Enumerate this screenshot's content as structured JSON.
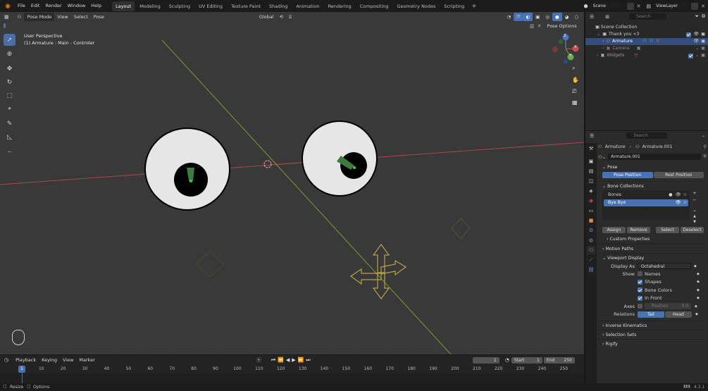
{
  "menu": [
    "File",
    "Edit",
    "Render",
    "Window",
    "Help"
  ],
  "workspaces": [
    "Layout",
    "Modeling",
    "Sculpting",
    "UV Editing",
    "Texture Paint",
    "Shading",
    "Animation",
    "Rendering",
    "Compositing",
    "Geometry Nodes",
    "Scripting"
  ],
  "active_workspace": "Layout",
  "scene": "Scene",
  "view_layer": "ViewLayer",
  "viewport": {
    "mode": "Pose Mode",
    "menus": [
      "View",
      "Select",
      "Pose"
    ],
    "transform_orientation": "Global",
    "pose_options": "Pose Options",
    "overlay_line1": "User Perspective",
    "overlay_line2": "(1) Armature : Main - Controler",
    "gizmo_axes": [
      "Z",
      "X",
      "Y"
    ]
  },
  "outliner": {
    "search_placeholder": "Search",
    "items": [
      {
        "label": "Scene Collection",
        "indent": 0
      },
      {
        "label": "Thank you <3",
        "indent": 1
      },
      {
        "label": "Armature",
        "indent": 2,
        "selected": true
      },
      {
        "label": "Camera",
        "indent": 2,
        "dim": true
      },
      {
        "label": "Widgets",
        "indent": 1,
        "dim": true
      }
    ]
  },
  "properties": {
    "search_placeholder": "Search",
    "breadcrumb_object": "Armature",
    "breadcrumb_data": "Armature.001",
    "data_name": "Armature.001",
    "pose_section": "Pose",
    "pose_position": "Pose Position",
    "rest_position": "Rest Position",
    "bone_collections_section": "Bone Collections",
    "bone_collections": [
      {
        "name": "Bones",
        "selected": false
      },
      {
        "name": "Bye Bye",
        "selected": true
      }
    ],
    "assign": "Assign",
    "remove": "Remove",
    "select": "Select",
    "deselect": "Deselect",
    "custom_properties": "Custom Properties",
    "motion_paths": "Motion Paths",
    "viewport_display": "Viewport Display",
    "display_as_label": "Display As",
    "display_as_value": "Octahedral",
    "show_label": "Show",
    "names": "Names",
    "shapes": "Shapes",
    "bone_colors": "Bone Colors",
    "in_front": "In Front",
    "axes_label": "Axes",
    "position_label": "Position",
    "position_value": "0.0",
    "relations_label": "Relations",
    "tail": "Tail",
    "head": "Head",
    "inverse_kinematics": "Inverse Kinematics",
    "selection_sets": "Selection Sets",
    "rigify": "Rigify"
  },
  "timeline": {
    "menus": [
      "Playback",
      "Keying",
      "View",
      "Marker"
    ],
    "current_frame": "1",
    "start_label": "Start",
    "start": "1",
    "end_label": "End",
    "end": "250",
    "ticks": [
      "1",
      "10",
      "20",
      "30",
      "40",
      "50",
      "60",
      "70",
      "80",
      "90",
      "100",
      "110",
      "120",
      "130",
      "140",
      "150",
      "160",
      "170",
      "180",
      "190",
      "200",
      "210",
      "220",
      "230",
      "240",
      "250"
    ]
  },
  "status": {
    "left1": "Resize",
    "left2": "Options",
    "version": "4.3.1"
  }
}
